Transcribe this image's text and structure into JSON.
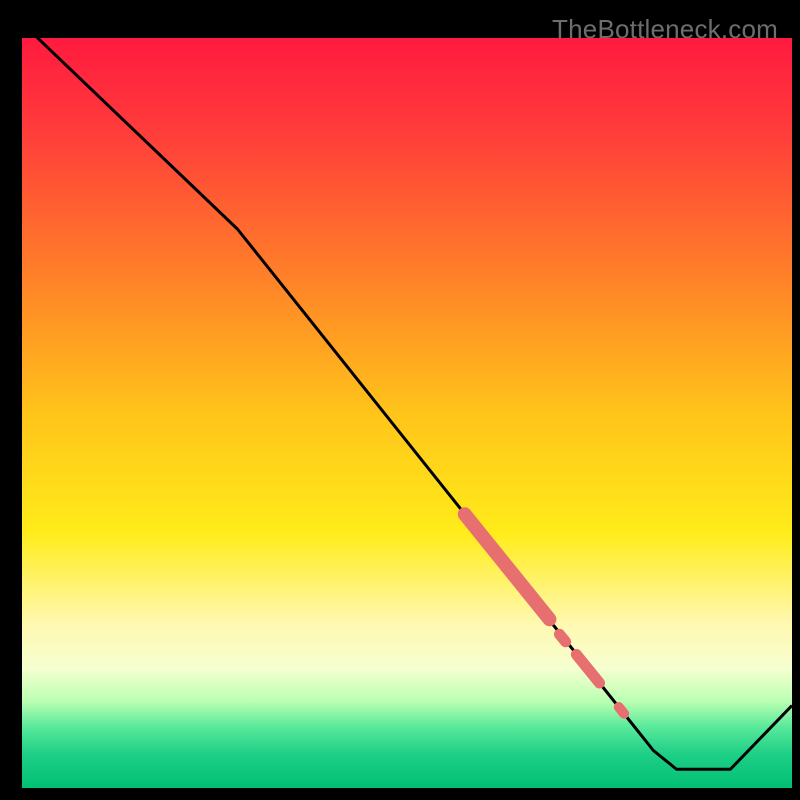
{
  "watermark": "TheBottleneck.com",
  "chart_data": {
    "type": "line",
    "title": "",
    "xlabel": "",
    "ylabel": "",
    "xlim": [
      0,
      100
    ],
    "ylim": [
      0,
      100
    ],
    "gradient_stops": [
      {
        "offset": 0.0,
        "color": "#ff1a3f"
      },
      {
        "offset": 0.12,
        "color": "#ff3b3b"
      },
      {
        "offset": 0.3,
        "color": "#ff7a2a"
      },
      {
        "offset": 0.5,
        "color": "#ffc41a"
      },
      {
        "offset": 0.66,
        "color": "#ffec1a"
      },
      {
        "offset": 0.78,
        "color": "#fff8b0"
      },
      {
        "offset": 0.84,
        "color": "#f6ffd0"
      },
      {
        "offset": 0.885,
        "color": "#b9ffb2"
      },
      {
        "offset": 0.92,
        "color": "#55e89a"
      },
      {
        "offset": 0.955,
        "color": "#1ecf86"
      },
      {
        "offset": 1.0,
        "color": "#00c074"
      }
    ],
    "series": [
      {
        "name": "bottleneck-curve",
        "color": "#000000",
        "points": [
          {
            "x": 0.0,
            "y": 102.0
          },
          {
            "x": 28.0,
            "y": 74.5
          },
          {
            "x": 82.0,
            "y": 5.0
          },
          {
            "x": 85.0,
            "y": 2.5
          },
          {
            "x": 92.0,
            "y": 2.5
          },
          {
            "x": 100.0,
            "y": 11.0
          }
        ]
      }
    ],
    "highlight": {
      "color": "#e76f6f",
      "segments": [
        {
          "x1": 57.5,
          "y1": 36.5,
          "x2": 68.5,
          "y2": 22.5,
          "width": 14
        },
        {
          "x1": 69.8,
          "y1": 20.5,
          "x2": 70.6,
          "y2": 19.5,
          "width": 11
        },
        {
          "x1": 72.0,
          "y1": 17.8,
          "x2": 75.0,
          "y2": 14.0,
          "width": 11
        },
        {
          "x1": 77.5,
          "y1": 10.8,
          "x2": 78.2,
          "y2": 9.9,
          "width": 10
        }
      ]
    }
  }
}
